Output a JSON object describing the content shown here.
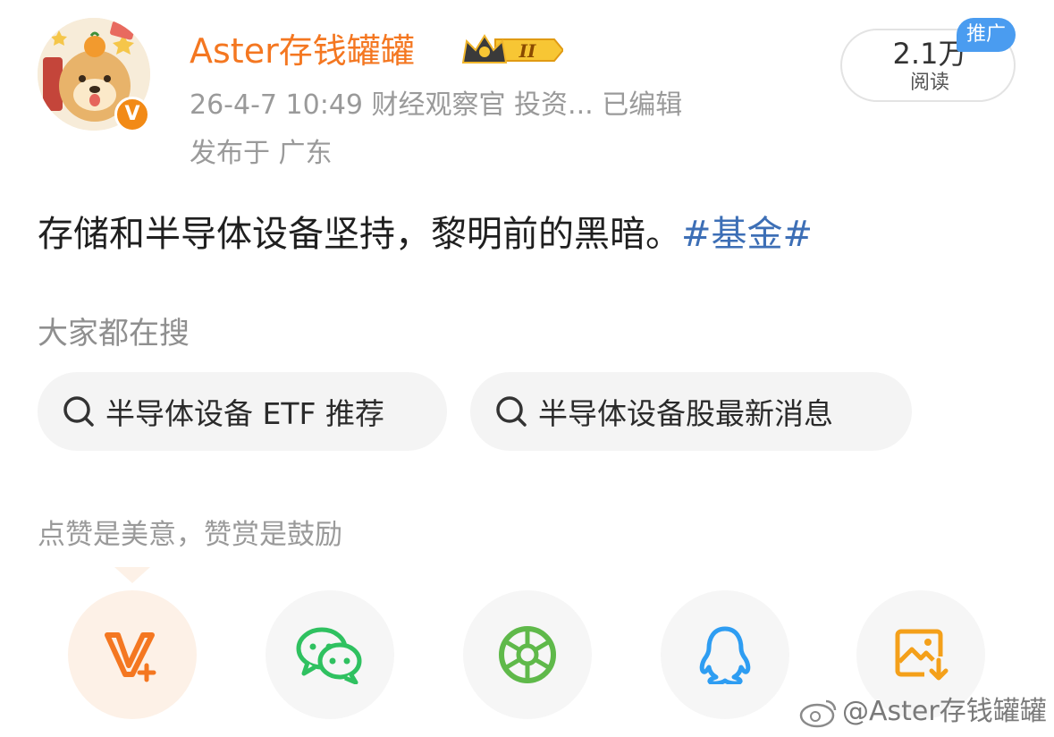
{
  "author": {
    "name": "Aster存钱罐罐",
    "level_badge": "II",
    "verified_badge": "V"
  },
  "meta": {
    "time_source": "26-4-7 10:49  财经观察官 投资...  已编辑",
    "location": "发布于 广东"
  },
  "stats": {
    "reads_count": "2.1万",
    "reads_label": "阅读",
    "promo_label": "推广"
  },
  "post": {
    "text": "存储和半导体设备坚持，黎明前的黑暗。",
    "hashtag": "#基金#"
  },
  "search": {
    "heading": "大家都在搜",
    "chips": [
      {
        "label": "半导体设备 ETF 推荐"
      },
      {
        "label": "半导体设备股最新消息"
      }
    ]
  },
  "reward": {
    "heading": "点赞是美意，赞赏是鼓励"
  },
  "share_buttons": [
    {
      "icon": "weibo-v-plus-icon"
    },
    {
      "icon": "wechat-icon"
    },
    {
      "icon": "moments-aperture-icon"
    },
    {
      "icon": "qq-penguin-icon"
    },
    {
      "icon": "save-image-icon"
    }
  ],
  "watermark": {
    "text": "@Aster存钱罐罐"
  },
  "colors": {
    "username": "#f47721",
    "hashtag": "#3d6fb6",
    "wechat": "#2fc160",
    "moments": "#5fb94a",
    "qq": "#2e9df2",
    "save": "#f4a01a",
    "promo": "#4a9cf0"
  }
}
